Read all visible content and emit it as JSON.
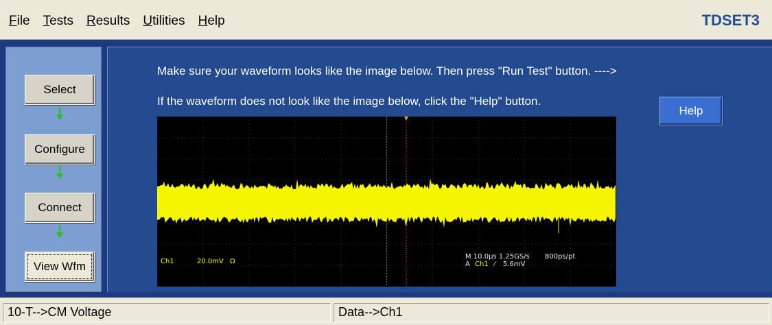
{
  "menu": {
    "items": [
      {
        "mnemonic": "F",
        "rest": "ile"
      },
      {
        "mnemonic": "T",
        "rest": "ests"
      },
      {
        "mnemonic": "R",
        "rest": "esults"
      },
      {
        "mnemonic": "U",
        "rest": "tilities"
      },
      {
        "mnemonic": "H",
        "rest": "elp"
      }
    ]
  },
  "app_title": "TDSET3",
  "nav": {
    "select": "Select",
    "configure": "Configure",
    "connect": "Connect",
    "view_wfm": "View Wfm"
  },
  "instructions": {
    "line1": "Make sure your waveform looks like the image below. Then press \"Run Test\" button. ---->",
    "line2": "If the waveform does not look like the image below, click the \"Help\" button."
  },
  "help_button": "Help",
  "scope": {
    "channel": "Ch1",
    "scale": "20.0mV",
    "coupling_symbol": "Ω",
    "horizontal": "M 10.0µs 1.25GS/s",
    "trigger_prefix": "A",
    "trigger_channel": "Ch1",
    "trigger_slope": "⁄",
    "trigger_level": "5.6mV",
    "record": "800ps/pt",
    "waveform_color": "#f5f500",
    "channel_color": "#f5f500"
  },
  "status": {
    "left": "10-T-->CM Voltage",
    "right": "Data-->Ch1"
  }
}
